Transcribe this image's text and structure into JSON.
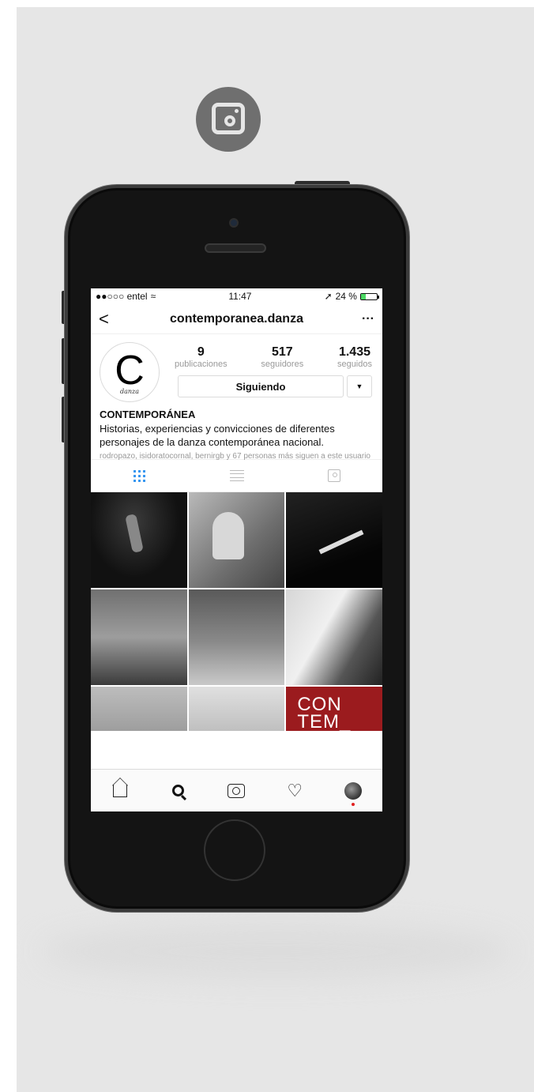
{
  "statusbar": {
    "carrier": "●●○○○ entel",
    "time": "11:47",
    "battery_text": "24 %"
  },
  "navbar": {
    "back": "<",
    "username": "contemporanea.danza",
    "more": "···"
  },
  "profile": {
    "avatar_letter": "C",
    "avatar_script": "danza",
    "stats": [
      {
        "num": "9",
        "label": "publicaciones"
      },
      {
        "num": "517",
        "label": "seguidores"
      },
      {
        "num": "1.435",
        "label": "seguidos"
      }
    ],
    "follow_label": "Siguiendo",
    "caret": "▼",
    "name": "CONTEMPORÁNEA",
    "bio": "Historias, experiencias y convicciones de diferentes personajes de la danza contemporánea nacional.",
    "followed_by": "rodropazo, isidoratocornal, bernirgb y 67 personas más siguen a este usuario"
  },
  "grid": {
    "tile9_line1": "CON",
    "tile9_line2": "TEM_"
  },
  "colors": {
    "accent": "#3897f0",
    "tile_red": "#9b1b1e",
    "notification": "#e02020"
  }
}
